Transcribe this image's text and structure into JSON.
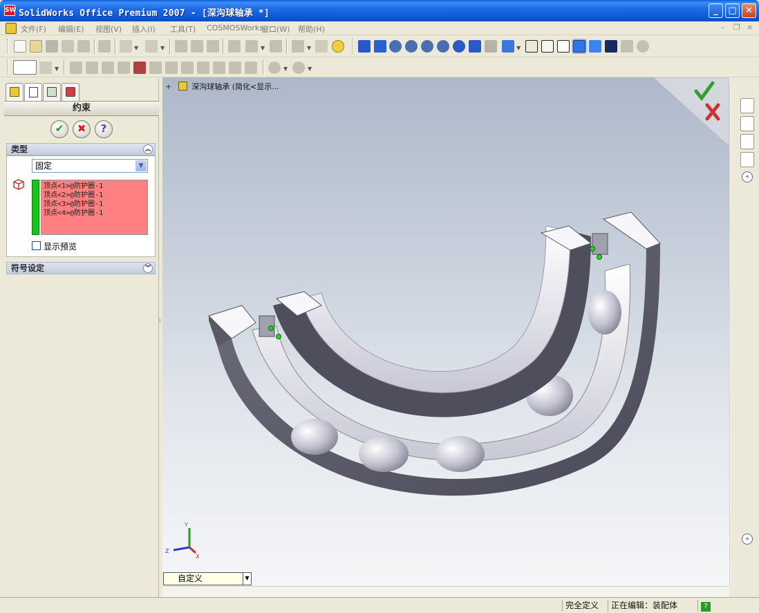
{
  "window": {
    "title": "SolidWorks Office Premium 2007 - [深沟球轴承 *]",
    "app_icon_text": "SW"
  },
  "menu": {
    "items": [
      "文件(F)",
      "编辑(E)",
      "视图(V)",
      "插入(I)",
      "工具(T)",
      "COSMOSWorks",
      "窗口(W)",
      "帮助(H)"
    ]
  },
  "property_manager": {
    "title": "约束",
    "type_section": {
      "label": "类型",
      "selected": "固定"
    },
    "vertices": [
      "顶点<1>@防护圈-1",
      "顶点<2>@防护圈-1",
      "顶点<3>@防护圈-1",
      "顶点<4>@防护圈-1"
    ],
    "show_preview_label": "显示预览",
    "symbol_section_label": "符号设定"
  },
  "viewport": {
    "tree_item": "深沟球轴承  (简化<显示...",
    "view_combo": "自定义",
    "triad": {
      "x": "X",
      "y": "Y",
      "z": "Z"
    }
  },
  "status_bar": {
    "state": "完全定义",
    "editing": "正在编辑：装配体",
    "help_icon": "?"
  },
  "colors": {
    "accent_green": "#18c418",
    "vertex_list_bg": "#ff8080",
    "title_blue": "#0d58d6"
  }
}
